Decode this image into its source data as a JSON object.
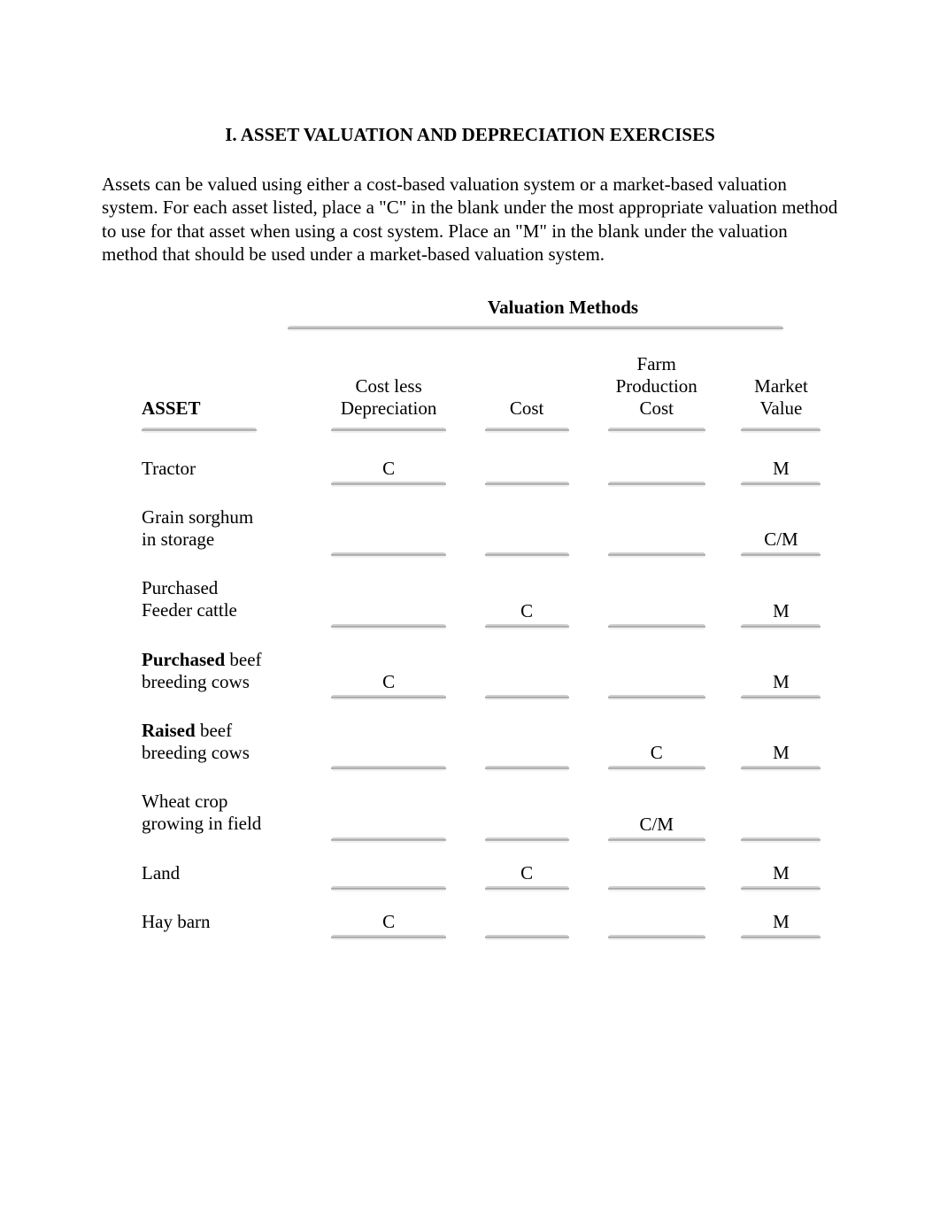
{
  "title": "I. ASSET VALUATION AND DEPRECIATION EXERCISES",
  "intro": "Assets can be valued using either a cost-based valuation system or a market-based valuation system.  For each asset listed, place a \"C\" in the blank under the most appropriate valuation method to use for that asset when using a cost system.  Place an \"M\" in the blank under the valuation method that should be used under a market-based valuation system.",
  "section_heading": "Valuation Methods",
  "columns": {
    "asset": "ASSET",
    "cost_less_depr_line1": "Cost less",
    "cost_less_depr_line2": "Depreciation",
    "cost": "Cost",
    "farm_prod_line1": "Farm",
    "farm_prod_line2": "Production",
    "farm_prod_line3": "Cost",
    "market_line1": "Market",
    "market_line2": "Value"
  },
  "rows": [
    {
      "asset_line1": "Tractor",
      "asset_line2": "",
      "bold_word": "",
      "cld": "C",
      "cost": "",
      "fpc": "",
      "mv": "M"
    },
    {
      "asset_line1": "Grain sorghum",
      "asset_line2": "in storage",
      "bold_word": "",
      "cld": "",
      "cost": "",
      "fpc": "",
      "mv": "C/M"
    },
    {
      "asset_line1": "Purchased",
      "asset_line2": "Feeder cattle",
      "bold_word": "",
      "cld": "",
      "cost": "C",
      "fpc": "",
      "mv": "M"
    },
    {
      "asset_line1": "",
      "asset_line2": "breeding cows",
      "bold_word": "Purchased",
      "bold_suffix": " beef",
      "cld": "C",
      "cost": "",
      "fpc": "",
      "mv": "M"
    },
    {
      "asset_line1": "",
      "asset_line2": "breeding cows",
      "bold_word": "Raised",
      "bold_suffix": " beef",
      "cld": "",
      "cost": "",
      "fpc": "C",
      "mv": "M"
    },
    {
      "asset_line1": "Wheat crop",
      "asset_line2": "growing in field",
      "bold_word": "",
      "cld": "",
      "cost": "",
      "fpc": "C/M",
      "mv": ""
    },
    {
      "asset_line1": "Land",
      "asset_line2": "",
      "bold_word": "",
      "cld": "",
      "cost": "C",
      "fpc": "",
      "mv": "M"
    },
    {
      "asset_line1": "Hay barn",
      "asset_line2": "",
      "bold_word": "",
      "cld": "C",
      "cost": "",
      "fpc": "",
      "mv": "M"
    }
  ]
}
